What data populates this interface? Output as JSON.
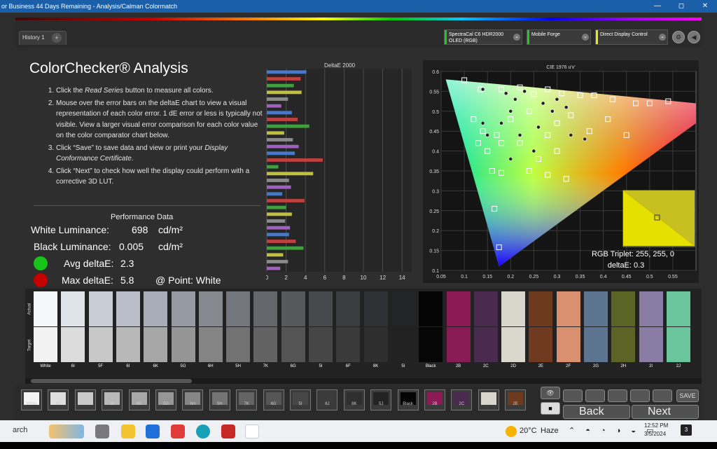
{
  "window": {
    "title": "or Business 44 Days Remaining  - Analysis/Calman Colormatch",
    "min": "—",
    "max": "◻",
    "close": "✕"
  },
  "toolbar": {
    "tab": "History 1",
    "tab_add": "+",
    "dropdowns": [
      {
        "line1": "SpectraCal C6 HDR2000",
        "line2": "OLED (RGB)",
        "color": "#27c427"
      },
      {
        "line1": "Mobile Forge",
        "line2": "",
        "color": "#27c427"
      },
      {
        "line1": "Direct Display Control",
        "line2": "",
        "color": "#e5e51a"
      }
    ],
    "chev": "⌄",
    "settings_icon": "⚙",
    "arrow_icon": "◀"
  },
  "page": {
    "title": "ColorChecker® Analysis",
    "steps": [
      {
        "pre": "Click the ",
        "em": "Read Series",
        "post": " button to measure all colors."
      },
      {
        "pre": "Mouse over the error bars on the deltaE chart to view a visual representation of each color error. 1 dE error or less is typically not visible. View a larger visual error comparison for each color value on the color comparator chart below.",
        "em": "",
        "post": ""
      },
      {
        "pre": "Click “Save” to save data and view or print your ",
        "em": "Display Conformance Certificate",
        "post": "."
      },
      {
        "pre": "Click “Next” to check how well the display could perform with a corrective 3D LUT.",
        "em": "",
        "post": ""
      }
    ]
  },
  "performance": {
    "title": "Performance Data",
    "white_label": "White Luminance:",
    "white_value": "698",
    "white_unit": "cd/m²",
    "black_label": "Black Luminance:",
    "black_value": "0.005",
    "black_unit": "cd/m²",
    "avg_label": "Avg deltaE:",
    "avg_value": "2.3",
    "max_label": "Max deltaE:",
    "max_value": "5.8",
    "max_point": "@ Point: White",
    "good_color": "#18c418",
    "bad_color": "#c40000"
  },
  "chart_data": [
    {
      "type": "bar",
      "title": "DeltaE 2000",
      "orientation": "horizontal",
      "xlim": [
        0,
        15
      ],
      "ticks": [
        "0",
        "2",
        "4",
        "6",
        "8",
        "10",
        "12",
        "14"
      ],
      "values": [
        4.1,
        3.5,
        2.8,
        3.6,
        2.2,
        1.5,
        2.6,
        3.2,
        4.4,
        1.8,
        2.7,
        3.3,
        2.9,
        5.8,
        1.2,
        4.8,
        2.3,
        2.5,
        1.6,
        3.9,
        2.0,
        2.6,
        1.9,
        2.4,
        2.3,
        3.0,
        3.8,
        1.7,
        2.2,
        1.4
      ]
    },
    {
      "type": "scatter",
      "title": "CIE 1976 u'v'",
      "xlim": [
        0.05,
        0.6
      ],
      "ylim": [
        0.1,
        0.6
      ],
      "xticks": [
        "0.05",
        "0.1",
        "0.15",
        "0.2",
        "0.25",
        "0.3",
        "0.35",
        "0.4",
        "0.45",
        "0.5",
        "0.55"
      ],
      "yticks": [
        "0.6",
        "0.55",
        "0.5",
        "0.45",
        "0.4",
        "0.35",
        "0.3",
        "0.25",
        "0.2",
        "0.15",
        "0.1"
      ],
      "targets": [
        [
          0.1,
          0.578
        ],
        [
          0.135,
          0.555
        ],
        [
          0.18,
          0.555
        ],
        [
          0.22,
          0.56
        ],
        [
          0.28,
          0.555
        ],
        [
          0.25,
          0.543
        ],
        [
          0.31,
          0.545
        ],
        [
          0.35,
          0.54
        ],
        [
          0.38,
          0.54
        ],
        [
          0.42,
          0.53
        ],
        [
          0.47,
          0.52
        ],
        [
          0.5,
          0.52
        ],
        [
          0.54,
          0.525
        ],
        [
          0.12,
          0.48
        ],
        [
          0.14,
          0.45
        ],
        [
          0.17,
          0.44
        ],
        [
          0.2,
          0.48
        ],
        [
          0.24,
          0.5
        ],
        [
          0.28,
          0.44
        ],
        [
          0.3,
          0.47
        ],
        [
          0.33,
          0.49
        ],
        [
          0.37,
          0.45
        ],
        [
          0.41,
          0.48
        ],
        [
          0.45,
          0.44
        ],
        [
          0.13,
          0.42
        ],
        [
          0.15,
          0.4
        ],
        [
          0.18,
          0.42
        ],
        [
          0.22,
          0.42
        ],
        [
          0.26,
          0.38
        ],
        [
          0.3,
          0.4
        ],
        [
          0.16,
          0.35
        ],
        [
          0.18,
          0.345
        ],
        [
          0.24,
          0.35
        ],
        [
          0.28,
          0.34
        ],
        [
          0.32,
          0.33
        ],
        [
          0.165,
          0.255
        ],
        [
          0.175,
          0.158
        ]
      ],
      "measured": [
        [
          0.14,
          0.555
        ],
        [
          0.19,
          0.545
        ],
        [
          0.23,
          0.55
        ],
        [
          0.27,
          0.52
        ],
        [
          0.3,
          0.53
        ],
        [
          0.32,
          0.51
        ],
        [
          0.2,
          0.5
        ],
        [
          0.18,
          0.47
        ],
        [
          0.26,
          0.46
        ],
        [
          0.33,
          0.44
        ],
        [
          0.36,
          0.43
        ],
        [
          0.15,
          0.44
        ],
        [
          0.22,
          0.44
        ],
        [
          0.2,
          0.38
        ],
        [
          0.25,
          0.4
        ],
        [
          0.14,
          0.47
        ],
        [
          0.29,
          0.5
        ],
        [
          0.21,
          0.53
        ]
      ],
      "inset": {
        "rgb": "RGB Triplet: 255, 255, 0",
        "de": "deltaE: 0.3"
      }
    }
  ],
  "swatches": {
    "actual_label": "Actual",
    "target_label": "Target",
    "items": [
      {
        "name": "White",
        "a": "#f4f6fa",
        "t": "#f2f2f2"
      },
      {
        "name": "6I",
        "a": "#dfe3ea",
        "t": "#dcdcdc"
      },
      {
        "name": "5F",
        "a": "#c9cdd6",
        "t": "#c8c8c8"
      },
      {
        "name": "6I",
        "a": "#b9bec8",
        "t": "#b8b8b8"
      },
      {
        "name": "6K",
        "a": "#a8adb7",
        "t": "#a7a7a7"
      },
      {
        "name": "5G",
        "a": "#969aa3",
        "t": "#959595"
      },
      {
        "name": "6H",
        "a": "#86898f",
        "t": "#848484"
      },
      {
        "name": "5H",
        "a": "#74777d",
        "t": "#727272"
      },
      {
        "name": "7K",
        "a": "#64666b",
        "t": "#626262"
      },
      {
        "name": "6G",
        "a": "#56585c",
        "t": "#545454"
      },
      {
        "name": "5I",
        "a": "#47494c",
        "t": "#464646"
      },
      {
        "name": "6F",
        "a": "#3b3c3f",
        "t": "#3a3a3a"
      },
      {
        "name": "8K",
        "a": "#2f3033",
        "t": "#2e2e2e"
      },
      {
        "name": "5I",
        "a": "#232426",
        "t": "#222222"
      },
      {
        "name": "Black",
        "a": "#050505",
        "t": "#060606"
      },
      {
        "name": "2B",
        "a": "#8c1b55",
        "t": "#8a1c55"
      },
      {
        "name": "2C",
        "a": "#4a2a4e",
        "t": "#4a2a4e"
      },
      {
        "name": "2D",
        "a": "#d9d6cc",
        "t": "#dad7cd"
      },
      {
        "name": "2E",
        "a": "#6e3a1e",
        "t": "#6f3a1f"
      },
      {
        "name": "2F",
        "a": "#d89070",
        "t": "#d89070"
      },
      {
        "name": "2G",
        "a": "#5c7490",
        "t": "#5c7490"
      },
      {
        "name": "2H",
        "a": "#5a6424",
        "t": "#5b6425"
      },
      {
        "name": "2I",
        "a": "#8b7ca6",
        "t": "#8b7ca6"
      },
      {
        "name": "2J",
        "a": "#6ac49c",
        "t": "#6ac49c"
      }
    ]
  },
  "strip": {
    "items": [
      {
        "name": "White",
        "c": "#f4f4f4"
      },
      {
        "name": "6J",
        "c": "#dedede"
      },
      {
        "name": "5F",
        "c": "#c9c9c9"
      },
      {
        "name": "6I",
        "c": "#b9b9b9"
      },
      {
        "name": "6K",
        "c": "#a8a8a8"
      },
      {
        "name": "5G",
        "c": "#969696"
      },
      {
        "name": "6H",
        "c": "#868686"
      },
      {
        "name": "5H",
        "c": "#747474"
      },
      {
        "name": "7K",
        "c": "#646464"
      },
      {
        "name": "6G",
        "c": "#565656"
      },
      {
        "name": "5I",
        "c": "#474747"
      },
      {
        "name": "6J",
        "c": "#3b3b3b"
      },
      {
        "name": "8K",
        "c": "#2f2f2f"
      },
      {
        "name": "5J",
        "c": "#232323"
      },
      {
        "name": "Black",
        "c": "#050505"
      },
      {
        "name": "2B",
        "c": "#8c1b55"
      },
      {
        "name": "2C",
        "c": "#4a2a4e"
      },
      {
        "name": "2D",
        "c": "#d9d6cc"
      },
      {
        "name": "2E",
        "c": "#6e3a1e"
      }
    ],
    "back": "Back",
    "next": "Next",
    "save": "SAVE",
    "eye": "👁",
    "record": "■"
  },
  "taskbar": {
    "search": "arch",
    "weather_temp": "20°C",
    "weather_desc": "Haze",
    "time": "12:52 PM",
    "date": "3/5/2024",
    "notif": "3"
  }
}
